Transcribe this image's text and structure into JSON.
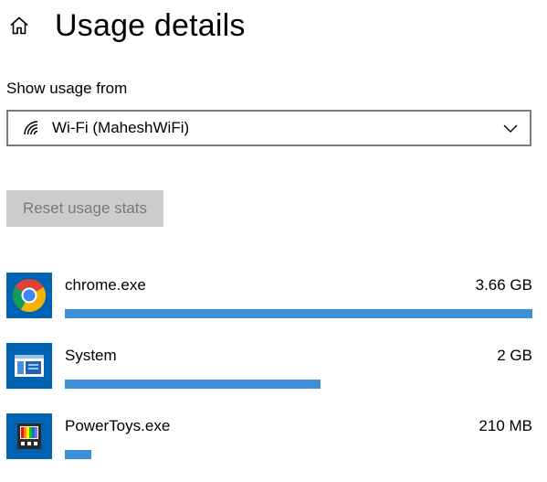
{
  "header": {
    "title": "Usage details",
    "home_icon": "home-icon"
  },
  "usage_source": {
    "label": "Show usage from",
    "selected": "Wi-Fi (MaheshWiFi)",
    "icon": "wifi-icon"
  },
  "reset_button": {
    "label": "Reset usage stats",
    "enabled": false
  },
  "apps": [
    {
      "name": "chrome.exe",
      "usage": "3.66 GB",
      "usage_fraction": 1.0,
      "icon": "chrome-icon"
    },
    {
      "name": "System",
      "usage": "2 GB",
      "usage_fraction": 0.546,
      "icon": "system-window-icon"
    },
    {
      "name": "PowerToys.exe",
      "usage": "210 MB",
      "usage_fraction": 0.056,
      "icon": "powertoys-icon"
    }
  ],
  "colors": {
    "accent": "#0063b1",
    "bar": "#3d8fd8",
    "disabled_button_bg": "#cccccc",
    "disabled_button_text": "#7a7a7a",
    "dropdown_border": "#7a7a7a"
  }
}
